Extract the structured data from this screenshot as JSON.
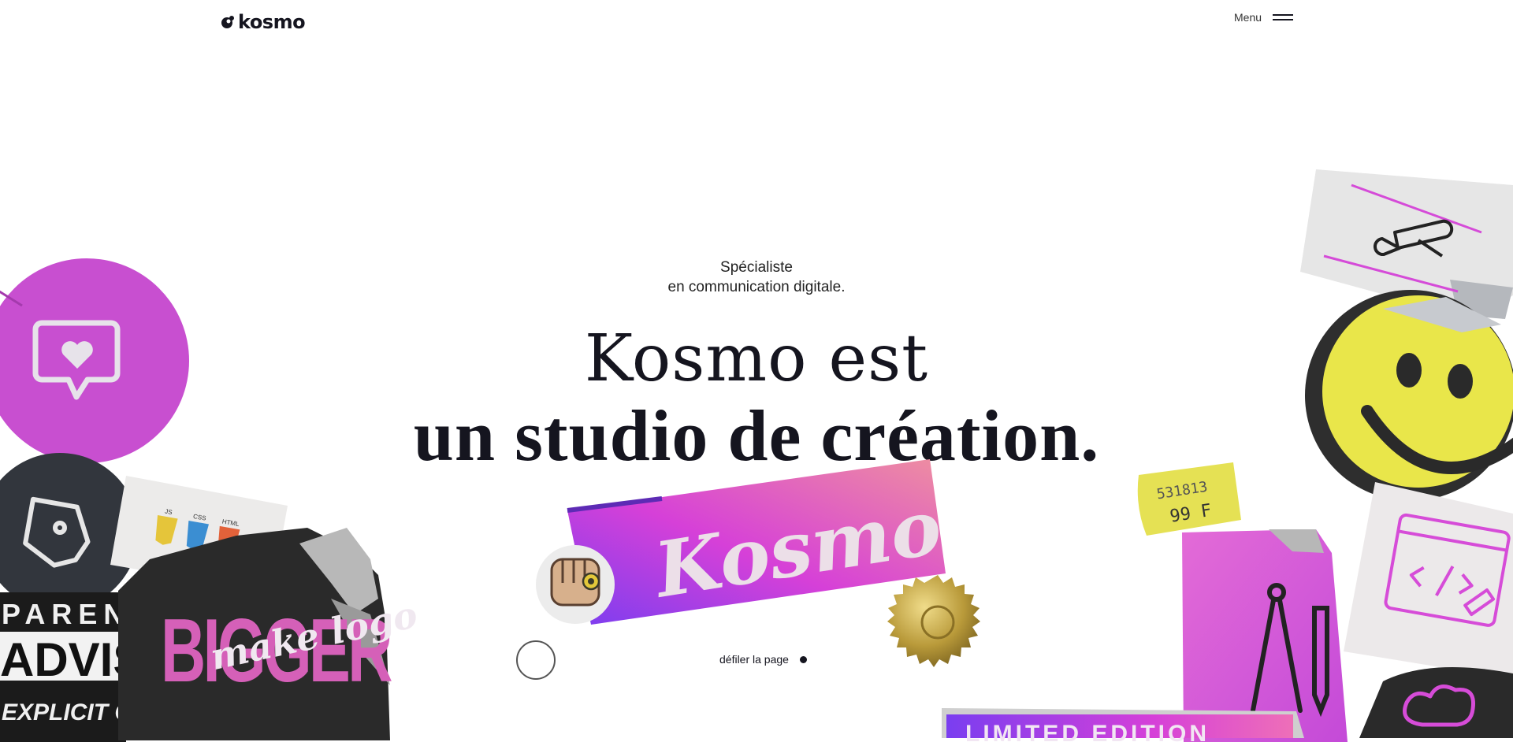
{
  "header": {
    "logo_text": "kosmo",
    "menu_label": "Menu"
  },
  "hero": {
    "subtitle_line1": "Spécialiste",
    "subtitle_line2": "en communication digitale.",
    "title_line1": "Kosmo est",
    "title_line2": "un studio de création.",
    "scroll_label": "défiler la page"
  },
  "stickers": {
    "kosmo_label": "Kosmo",
    "price_code": "531813",
    "price_value": "99 F",
    "js_badge": "JS",
    "css_badge": "CSS",
    "html_badge": "HTML",
    "advisory_line1": "PARENT",
    "advisory_line2": "ADVIS",
    "advisory_line3": "EXPLICIT C",
    "bigger_text": "BIGGER",
    "make_logo_text": "make logo",
    "limited_text": "LIMITED EDITION"
  },
  "icons": {
    "heart_message": "heart-message-icon",
    "pen_tool": "pen-tool-icon",
    "swiss_knife": "swiss-knife-icon",
    "smiley": "smiley-icon",
    "code_window": "code-window-icon",
    "compass": "compass-icon",
    "chef_hat": "chef-hat-icon",
    "fist": "fist-icon",
    "gold_seal": "gold-seal-icon"
  },
  "colors": {
    "ink": "#15151f",
    "magenta": "#c84fd0",
    "purple": "#7a3ef0",
    "pink": "#e85bb8",
    "yellow": "#e9e64a",
    "gold": "#b99a3a",
    "dark_slate": "#32363d"
  }
}
